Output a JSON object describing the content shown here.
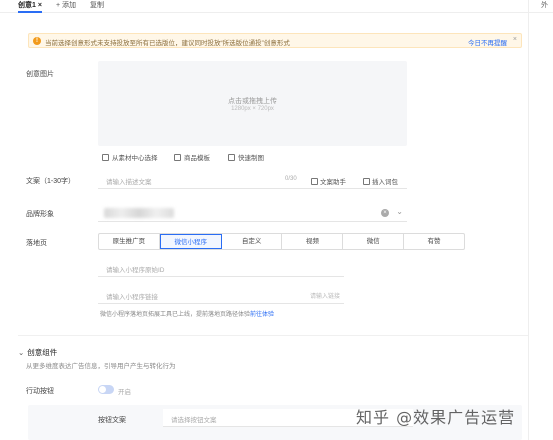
{
  "tabs": [
    {
      "label": "创意1 ×",
      "active": true
    },
    {
      "label": "+ 添加",
      "active": false
    },
    {
      "label": "复制",
      "active": false
    }
  ],
  "right_panel_label": "外",
  "alert": {
    "text": "当前选择创意形式未支持投放至所有已选版位，建议同时投放“所选版位通投”创意形式",
    "action": "今日不再提醒",
    "close": "×"
  },
  "creative_image": {
    "label": "创意图片",
    "upload_text": "点击或拖拽上传",
    "size_hint": "1280px × 720px",
    "links": [
      "从素材中心选择",
      "商品模板",
      "快速制图"
    ]
  },
  "copy_text": {
    "label": "文案（1-30字）",
    "placeholder": "请输入描述文案",
    "counter": "0/30",
    "assistant": "文案助手",
    "insert_word": "插入词包"
  },
  "brand": {
    "label": "品牌形象"
  },
  "landing": {
    "label": "落地页",
    "options": [
      "原生推广页",
      "微信小程序",
      "自定义",
      "视频",
      "微信",
      "有赞"
    ],
    "active_index": 1,
    "appid_placeholder": "请输入小程序原始ID",
    "link_placeholder": "请输入小程序链接",
    "link_hint": "请输入链接",
    "note_text": "微信小程序落地页拓展工具已上线，提前落地页路径体验",
    "note_link": "前往体验"
  },
  "component": {
    "title": "创意组件",
    "desc": "从更多维度表达广告信息，引导用户产生与转化行为",
    "cta_label": "行动按钮",
    "toggle_label": "开启",
    "button_text_label": "按钮文案",
    "button_text_placeholder": "请选择按钮文案"
  },
  "watermark": "知乎 @效果广告运营"
}
